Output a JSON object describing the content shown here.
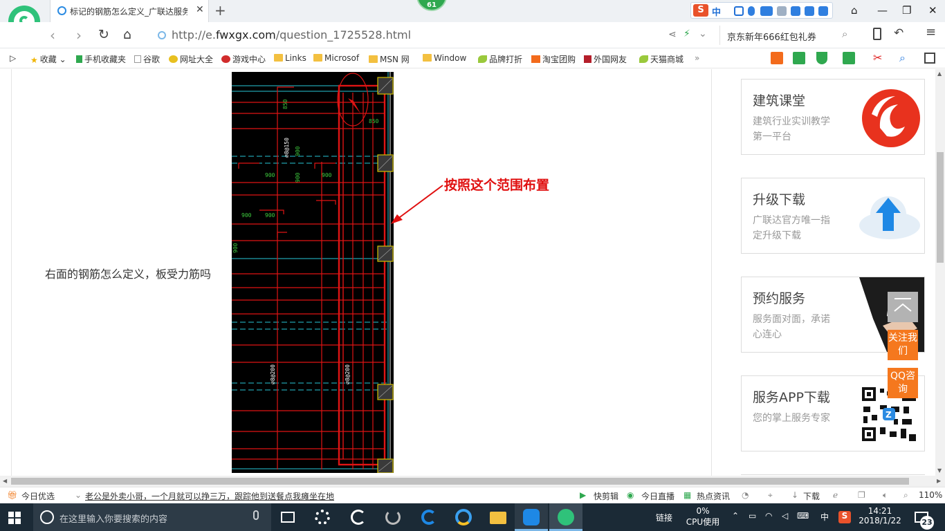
{
  "browser": {
    "tab_title": "标记的钢筋怎么定义_广联达服务",
    "badge_count": "61",
    "ime_label": "中",
    "url_prefix": "http://e.",
    "url_host": "fwxgx.com",
    "url_path": "/question_1725528.html",
    "search_text": "京东新年666红包礼券"
  },
  "bookmarks": [
    {
      "label": "收藏"
    },
    {
      "label": "手机收藏夹"
    },
    {
      "label": "谷歌"
    },
    {
      "label": "网址大全"
    },
    {
      "label": "游戏中心"
    },
    {
      "label": "Links"
    },
    {
      "label": "Microsof"
    },
    {
      "label": "MSN 网"
    },
    {
      "label": "Window"
    },
    {
      "label": "品牌打折"
    },
    {
      "label": "淘宝团购"
    },
    {
      "label": "外国网友"
    },
    {
      "label": "天猫商城"
    }
  ],
  "page": {
    "question_text": "右面的钢筋怎么定义，板受力筋吗",
    "annotation": "按照这个范围布置",
    "cad_labels": {
      "dim_850a": "850",
      "dim_850b": "850",
      "dim_900a": "900",
      "dim_900b": "900",
      "dim_900c": "900",
      "dim_900d": "900",
      "dim_900e": "900",
      "dim_900f": "900",
      "dim_900g": "900",
      "rebar_a": "⌀8@150",
      "rebar_b": "⌀8@200",
      "rebar_c": "⌀8@200"
    }
  },
  "sidebar": {
    "cards": [
      {
        "title": "建筑课堂",
        "subtitle": "建筑行业实训教学第一平台"
      },
      {
        "title": "升级下载",
        "subtitle": "广联达官方唯一指定升级下载"
      },
      {
        "title": "预约服务",
        "subtitle": "服务面对面，承诺心连心"
      },
      {
        "title": "服务APP下载",
        "subtitle": "您的掌上服务专家"
      }
    ],
    "follow_label": "关注我们",
    "qq_label": "QQ咨询"
  },
  "statusbar": {
    "today_label": "今日优选",
    "news_text": "老公是外卖小哥，一个月就可以挣三万，跟踪他到送餐点我瘫坐在地",
    "items": [
      "快剪辑",
      "今日直播",
      "热点资讯",
      "下载"
    ],
    "zoom": "110%"
  },
  "taskbar": {
    "search_placeholder": "在这里输入你要搜索的内容",
    "link_label": "链接",
    "cpu_value": "0%",
    "cpu_label": "CPU使用",
    "ime_label": "中",
    "time": "14:21",
    "date": "2018/1/22",
    "notif_count": "23"
  },
  "colors": {
    "cad_bg": "#000000",
    "cad_red": "#e01414",
    "cad_cyan": "#28c8d8",
    "cad_green": "#3ecb3e",
    "orange": "#f5781e",
    "brand_green": "#2fc27a"
  }
}
